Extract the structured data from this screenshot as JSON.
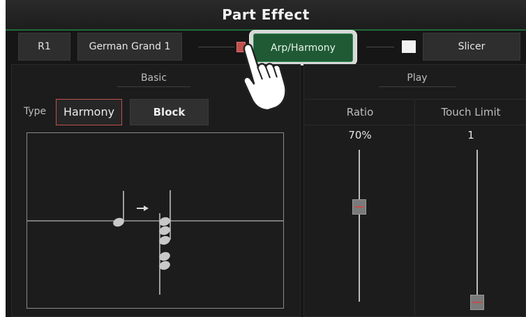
{
  "header": {
    "title": "Part Effect"
  },
  "toolbar": {
    "part_label": "R1",
    "voice_label": "German Grand 1",
    "effect_button_label": "Arp/Harmony",
    "slicer_label": "Slicer"
  },
  "basic": {
    "section_label": "Basic",
    "type_label": "Type",
    "type_options": [
      "Harmony",
      "Block"
    ],
    "selected_type": "Harmony"
  },
  "play": {
    "section_label": "Play",
    "ratio": {
      "label": "Ratio",
      "value_text": "70%",
      "value": 70
    },
    "touch_limit": {
      "label": "Touch Limit",
      "value_text": "1",
      "value": 1
    }
  },
  "colors": {
    "accent_green": "#1f6b3a",
    "selected_border_red": "#c0504d",
    "background": "#161616"
  },
  "icons": [
    "hand-pointer-icon",
    "arrow-right-icon",
    "note-icon"
  ]
}
